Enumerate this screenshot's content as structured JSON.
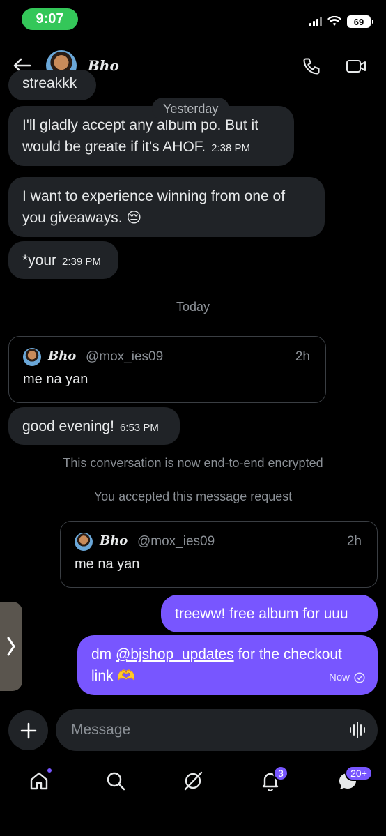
{
  "status_bar": {
    "time": "9:07",
    "battery": "69"
  },
  "header": {
    "contact_name": "𝑩𝒉𝒐"
  },
  "messages": {
    "cut_off_text": "streakkk",
    "day_yesterday": "Yesterday",
    "m1_text": "I'll gladly accept any album po. But it would be greate if it's AHOF.",
    "m1_time": "2:38 PM",
    "m2_text": "I want to experience winning from one of you giveaways. 😔",
    "m3_text": "*your",
    "m3_time": "2:39 PM",
    "day_today": "Today",
    "quote1": {
      "name": "𝑩𝒉𝒐",
      "handle": "@mox_ies09",
      "age": "2h",
      "text": "me na yan"
    },
    "m4_text": "good evening!",
    "m4_time": "6:53 PM",
    "system_encrypted": "This conversation is now end-to-end encrypted",
    "system_accepted": "You accepted this message request",
    "quote2": {
      "name": "𝑩𝒉𝒐",
      "handle": "@mox_ies09",
      "age": "2h",
      "text": "me na yan"
    },
    "me1_text": "treeww! free album for uuu",
    "me2_prefix": "dm ",
    "me2_mention": "@bjshop_updates",
    "me2_suffix": " for the checkout link 🫶",
    "me2_time": "Now"
  },
  "composer": {
    "placeholder": "Message"
  },
  "tab_bar": {
    "notifications_badge": "3",
    "messages_badge": "20+"
  },
  "colors": {
    "accent": "#7856ff",
    "bubble": "#202327",
    "status_green": "#34c759"
  }
}
